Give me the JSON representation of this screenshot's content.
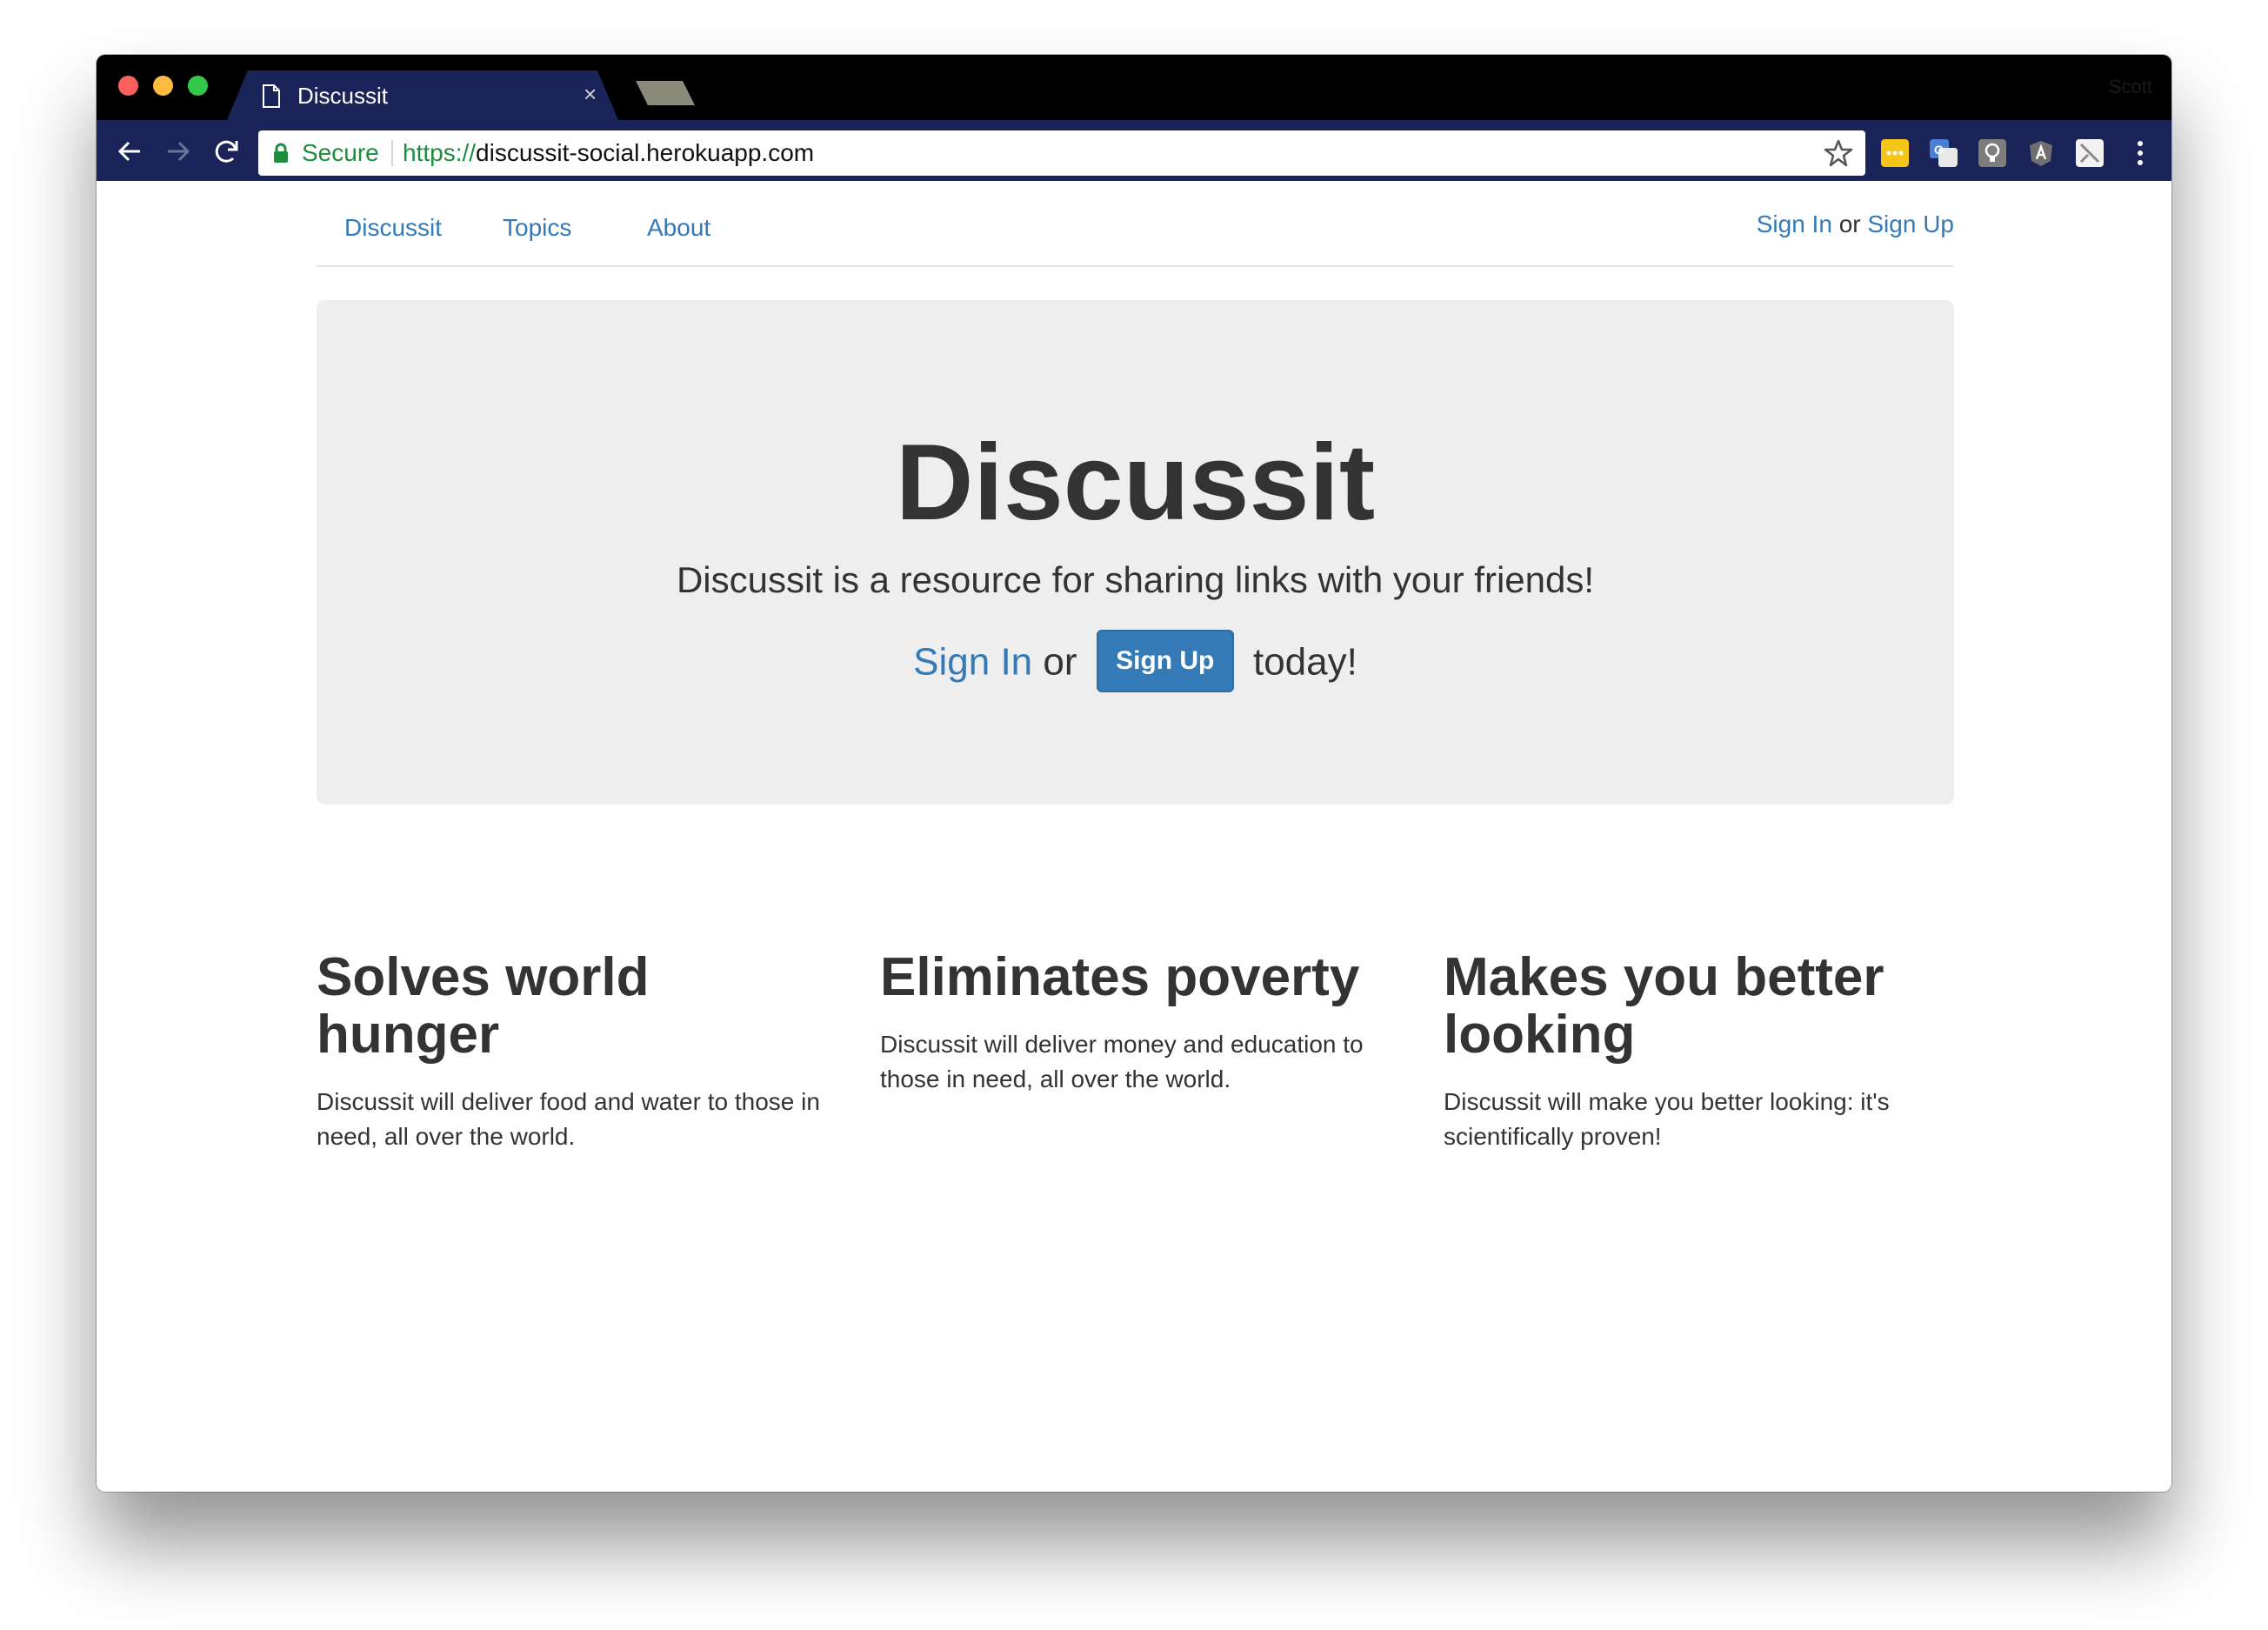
{
  "browser": {
    "tab_title": "Discussit",
    "tab_close": "×",
    "profile_name": "Scott",
    "secure_label": "Secure",
    "url_scheme": "https://",
    "url_host": "discussit-social.herokuapp.com",
    "icons": [
      "back-arrow-icon",
      "forward-arrow-icon",
      "reload-icon",
      "lock-icon",
      "star-icon",
      "extension-icons",
      "menu-dots-icon"
    ],
    "extension_colors": [
      "#f5c518",
      "#4a7fd6",
      "#7d7d7d",
      "#6f6f6f",
      "#f2f2f2"
    ]
  },
  "nav": {
    "links": [
      "Discussit",
      "Topics",
      "About"
    ],
    "sign_in": "Sign In",
    "or": "or",
    "sign_up": "Sign Up"
  },
  "hero": {
    "title": "Discussit",
    "lead": "Discussit is a resource for sharing links with your friends!",
    "sign_in": "Sign In",
    "or": "or",
    "sign_up_button": "Sign Up",
    "suffix": "today!"
  },
  "features": [
    {
      "heading": "Solves world hunger",
      "body": "Discussit will deliver food and water to those in need, all over the world."
    },
    {
      "heading": "Eliminates poverty",
      "body": "Discussit will deliver money and education to those in need, all over the world."
    },
    {
      "heading": "Makes you better looking",
      "body": "Discussit will make you better looking: it's scientifically proven!"
    }
  ],
  "colors": {
    "link": "#337ab7",
    "button": "#337ab7",
    "jumbotron_bg": "#eeeeee",
    "toolbar": "#1b2458",
    "text": "#333333"
  }
}
